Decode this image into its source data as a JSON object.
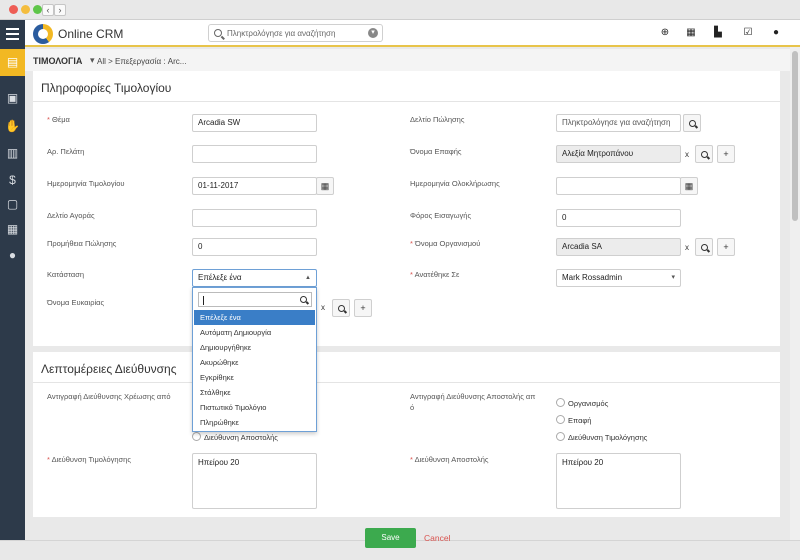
{
  "app": {
    "brand": "Online CRM"
  },
  "search": {
    "placeholder": "Πληκτρολόγησε για αναζήτηση"
  },
  "breadcrumb": {
    "module": "ΤΙΜΟΛΟΓΙΑ",
    "rest": "All  >  Επεξεργασία : Arc..."
  },
  "panel1": {
    "title": "Πληροφορίες Τιμολογίου",
    "fields": {
      "subject_label": "Θέμα",
      "subject_value": "Arcadia SW",
      "customer_no_label": "Αρ. Πελάτη",
      "invoice_date_label": "Ημερομηνία Τιμολογίου",
      "invoice_date_value": "01-11-2017",
      "purchase_order_label": "Δελτίο Αγοράς",
      "sales_commission_label": "Προμήθεια Πώλησης",
      "sales_commission_value": "0",
      "status_label": "Κατάσταση",
      "status_value": "Επέλεξε ένα",
      "opportunity_label": "Όνομα Ευκαιρίας",
      "sales_order_label": "Δελτίο Πώλησης",
      "sales_order_placeholder": "Πληκτρολόγησε για αναζήτηση",
      "contact_label": "Όνομα Επαφής",
      "contact_value": "Αλεξία Μητροπάνου",
      "due_date_label": "Ημερομηνία Ολοκλήρωσης",
      "excise_label": "Φόρος Εισαγωγής",
      "excise_value": "0",
      "organization_label": "Όνομα Οργανισμού",
      "organization_value": "Arcadia SA",
      "assigned_label": "Ανατέθηκε Σε",
      "assigned_value": "Mark Rossadmin"
    }
  },
  "status_dropdown": {
    "options": [
      "Επέλεξε ένα",
      "Αυτόματη Δημιουργία",
      "Δημιουργήθηκε",
      "Ακυρώθηκε",
      "Εγκρίθηκε",
      "Στάλθηκε",
      "Πιστωτικό Τιμολόγιο",
      "Πληρώθηκε"
    ]
  },
  "panel2": {
    "title": "Λεπτομέρειες Διεύθυνσης",
    "copy_billing_label": "Αντιγραφή Διεύθυνσης Χρέωσης από",
    "copy_billing_opt_shipping": "Διεύθυνση Αποστολής",
    "copy_shipping_label_1": "Αντιγραφή Διεύθυνσης Αποστολής απ",
    "copy_shipping_label_2": "ό",
    "copy_shipping_options": [
      "Οργανισμός",
      "Επαφή",
      "Διεύθυνση Τιμολόγησης"
    ],
    "billing_address_label": "Διεύθυνση Τιμολόγησης",
    "billing_address_value": "Ηπείρου 20",
    "shipping_address_label": "Διεύθυνση Αποστολής",
    "shipping_address_value": "Ηπείρου 20"
  },
  "actions": {
    "save": "Save",
    "cancel": "Cancel"
  },
  "icons": {
    "sidebar": [
      "invoice-icon",
      "box-icon",
      "handshake-icon",
      "contacts-icon",
      "dollar-icon",
      "document-icon",
      "building-icon",
      "user-icon"
    ],
    "topbar": [
      "add-icon",
      "calendar-icon",
      "chart-icon",
      "checklist-icon",
      "user-icon"
    ]
  },
  "colors": {
    "accent": "#f2b823",
    "sidebar": "#2d3a4a",
    "save": "#3caa4e",
    "required": "#d9534f",
    "selected": "#3a7ec7"
  }
}
